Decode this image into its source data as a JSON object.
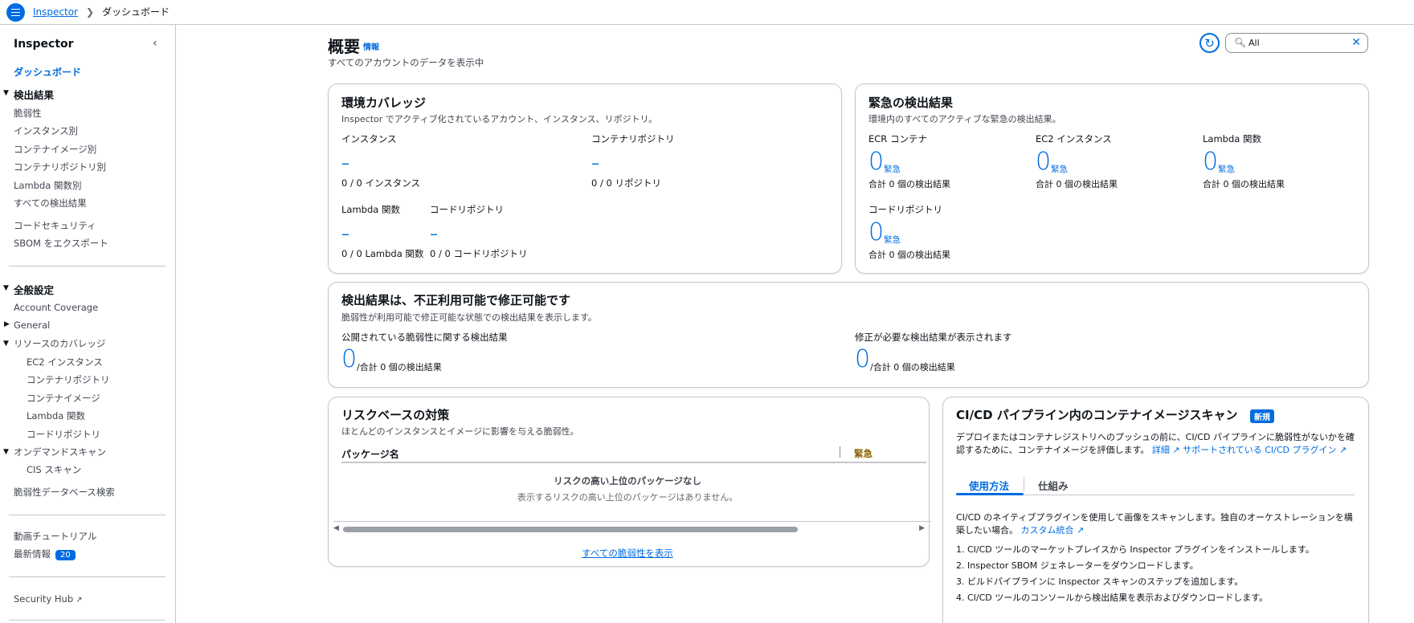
{
  "breadcrumb": {
    "root": "Inspector",
    "current": "ダッシュボード"
  },
  "sidebar": {
    "title": "Inspector",
    "dashboard": "ダッシュボード",
    "findings_head": "検出結果",
    "findings": [
      "脆弱性",
      "インスタンス別",
      "コンテナイメージ別",
      "コンテナリポジトリ別",
      "Lambda 関数別",
      "すべての検出結果"
    ],
    "code_security": "コードセキュリティ",
    "sbom_export": "SBOM をエクスポート",
    "general_settings_head": "全般設定",
    "account_coverage": "Account Coverage",
    "general": "General",
    "resource_coverage": "リソースのカバレッジ",
    "resources": [
      "EC2 インスタンス",
      "コンテナリポジトリ",
      "コンテナイメージ",
      "Lambda 関数",
      "コードリポジトリ"
    ],
    "on_demand": "オンデマンドスキャン",
    "cis_scan": "CIS スキャン",
    "vuln_db": "脆弱性データベース検索",
    "video_tutorial": "動画チュートリアル",
    "whats_new": "最新情報",
    "whats_new_count": "20",
    "security_hub": "Security Hub"
  },
  "header": {
    "title": "概要",
    "info": "情報",
    "subtitle": "すべてのアカウントのデータを表示中"
  },
  "search": {
    "value": "All"
  },
  "coverage": {
    "title": "環境カバレッジ",
    "desc": "Inspector でアクティブ化されているアカウント、インスタンス、リポジトリ。",
    "instances_label": "インスタンス",
    "instances_value": "–",
    "instances_sub": "0 / 0 インスタンス",
    "repos_label": "コンテナリポジトリ",
    "repos_value": "–",
    "repos_sub": "0 / 0 リポジトリ",
    "lambda_label": "Lambda 関数",
    "lambda_value": "–",
    "lambda_sub": "0 / 0 Lambda 関数",
    "code_label": "コードリポジトリ",
    "code_value": "–",
    "code_sub": "0 / 0 コードリポジトリ"
  },
  "critical": {
    "title": "緊急の検出結果",
    "desc": "環境内のすべてのアクティブな緊急の検出結果。",
    "items": [
      {
        "label": "ECR コンテナ",
        "value": "0",
        "suffix": "緊急",
        "total": "合計 0 個の検出結果"
      },
      {
        "label": "EC2 インスタンス",
        "value": "0",
        "suffix": "緊急",
        "total": "合計 0 個の検出結果"
      },
      {
        "label": "Lambda 関数",
        "value": "0",
        "suffix": "緊急",
        "total": "合計 0 個の検出結果"
      },
      {
        "label": "コードリポジトリ",
        "value": "0",
        "suffix": "緊急",
        "total": "合計 0 個の検出結果"
      }
    ]
  },
  "exploitable": {
    "title": "検出結果は、不正利用可能で修正可能です",
    "desc": "脆弱性が利用可能で修正可能な状態での検出結果を表示します。",
    "left_label": "公開されている脆弱性に関する検出結果",
    "left_value": "0",
    "left_total": "/合計 0 個の検出結果",
    "right_label": "修正が必要な検出結果が表示されます",
    "right_value": "0",
    "right_total": "/合計 0 個の検出結果"
  },
  "risk": {
    "title": "リスクベースの対策",
    "desc": "ほとんどのインスタンスとイメージに影響を与える脆弱性。",
    "col_package": "パッケージ名",
    "col_critical": "緊急",
    "empty_title": "リスクの高い上位のパッケージなし",
    "empty_sub": "表示するリスクの高い上位のパッケージはありません。",
    "view_all": "すべての脆弱性を表示"
  },
  "cicd": {
    "title": "CI/CD パイプライン内のコンテナイメージスキャン",
    "new_badge": "新規",
    "desc": "デプロイまたはコンテナレジストリへのプッシュの前に、CI/CD パイプラインに脆弱性がないかを確認するために、コンテナイメージを評価します。",
    "link_details": "詳細",
    "link_supported": "サポートされている CI/CD プラグイン",
    "tab_usage": "使用方法",
    "tab_how": "仕組み",
    "text": "CI/CD のネイティブプラグインを使用して画像をスキャンします。独自のオーケストレーションを構築したい場合。",
    "link_custom": "カスタム統合",
    "steps": [
      "1. CI/CD ツールのマーケットプレイスから Inspector プラグインをインストールします。",
      "2. Inspector SBOM ジェネレーターをダウンロードします。",
      "3. ビルドパイプラインに Inspector スキャンのステップを追加します。",
      "4. CI/CD ツールのコンソールから検出結果を表示およびダウンロードします。"
    ]
  }
}
